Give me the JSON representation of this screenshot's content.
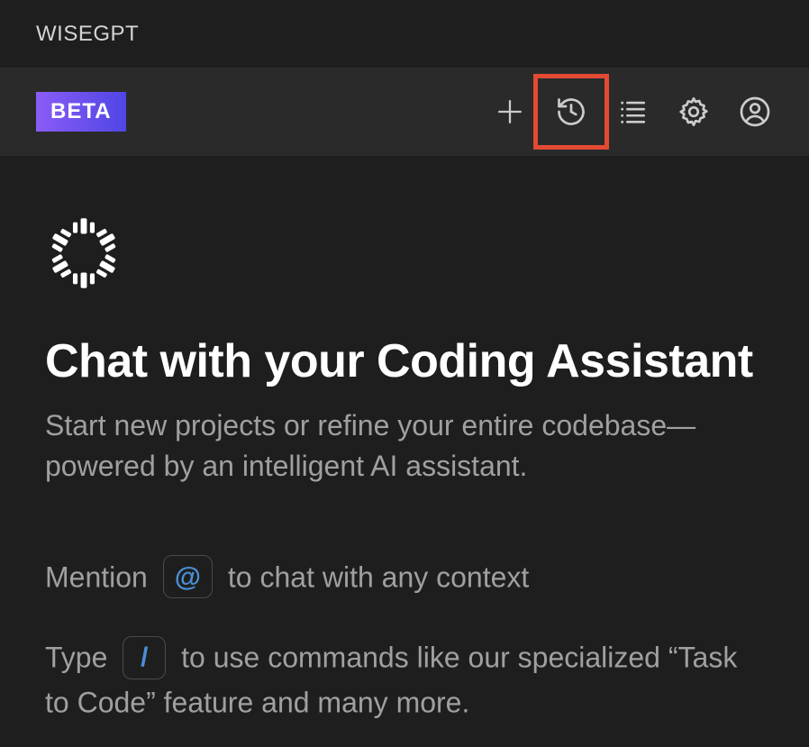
{
  "header": {
    "title": "WISEGPT"
  },
  "toolbar": {
    "badge": "BETA"
  },
  "main": {
    "heading": "Chat with your Coding Assistant",
    "subheading": "Start new projects or refine your entire codebase—powered by an intelligent AI assistant.",
    "hint1_pre": "Mention",
    "hint1_key": "@",
    "hint1_post": " to chat with any context",
    "hint2_pre": "Type",
    "hint2_key": "/",
    "hint2_post": " to use commands like our specialized “Task to Code” feature and many more."
  }
}
